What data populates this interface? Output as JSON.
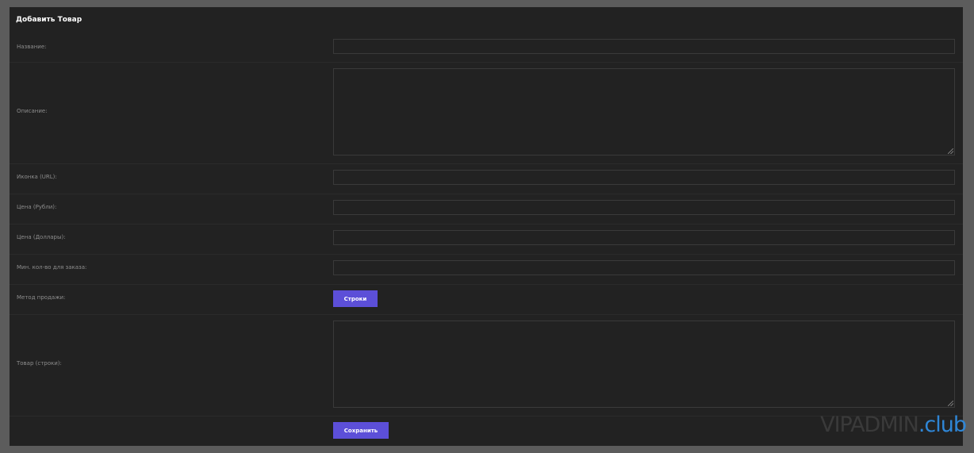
{
  "form": {
    "title": "Добавить Товар",
    "fields": {
      "name_label": "Название:",
      "description_label": "Описание:",
      "icon_label": "Иконка (URL):",
      "price_rub_label": "Цена (Рубли):",
      "price_usd_label": "Цена (Доллары):",
      "min_qty_label": "Мин. кол-во для заказа:",
      "sale_method_label": "Метод продажи:",
      "sale_method_button": "Строки",
      "product_label": "Товар (строки):"
    },
    "values": {
      "name": "",
      "description": "",
      "icon": "",
      "price_rub": "",
      "price_usd": "",
      "min_qty": "",
      "product": ""
    },
    "save_button": "Сохранить"
  },
  "watermark": {
    "part1": "VIPADMIN",
    "part2": ".club"
  },
  "colors": {
    "panel": "#222222",
    "accent": "#5c4fd8",
    "watermark_accent": "#2f86d6"
  }
}
